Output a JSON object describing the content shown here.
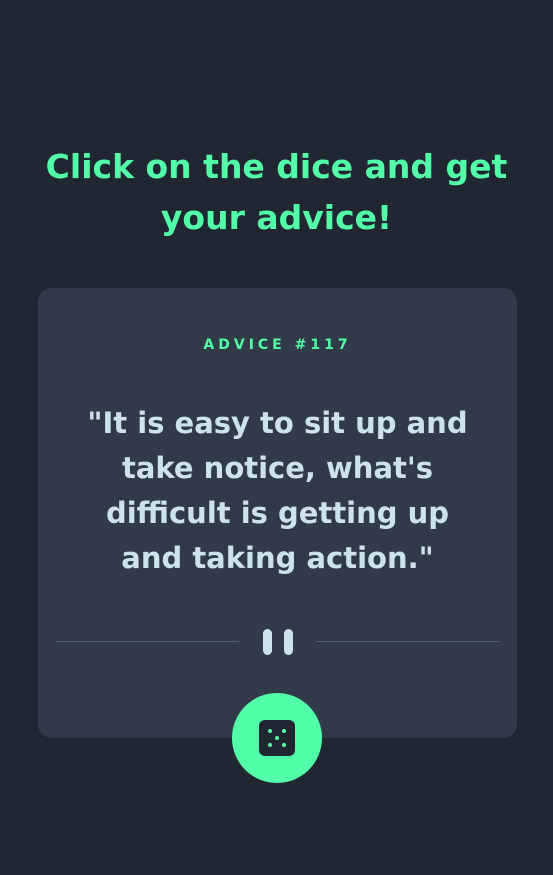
{
  "header": {
    "title": "Click on the dice and get your advice!"
  },
  "card": {
    "advice_id": "ADVICE #117",
    "quote": "\"It is easy to sit up and take notice, what's difficult is getting up and taking action.\""
  },
  "divider": {
    "icon": "pause-icon"
  },
  "dice_button": {
    "icon": "dice-icon"
  },
  "colors": {
    "background": "#202632",
    "card": "#313A48",
    "accent": "#52FFA8",
    "text": "#CEE3E9",
    "divider": "#4F5D74"
  }
}
